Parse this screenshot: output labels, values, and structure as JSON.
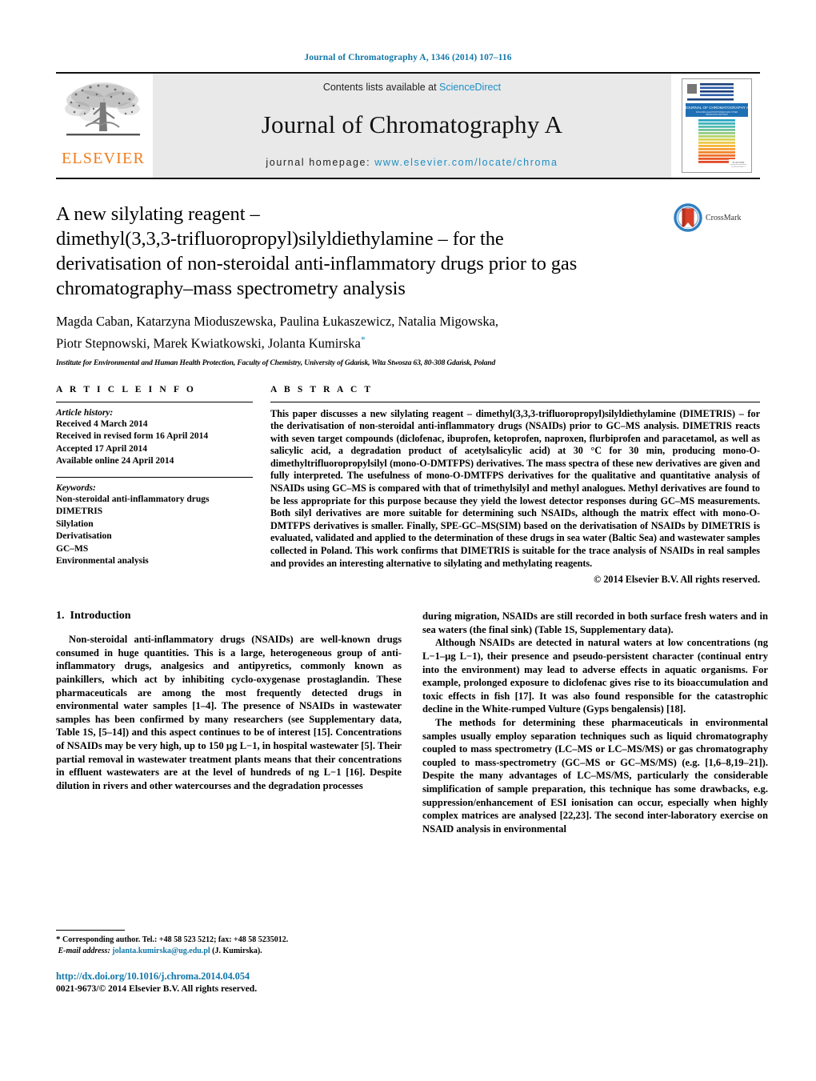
{
  "running_head": "Journal of Chromatography A, 1346 (2014) 107–116",
  "masthead": {
    "publisher_name": "ELSEVIER",
    "contents_prefix": "Contents lists available at ",
    "contents_link": "ScienceDirect",
    "journal_name": "Journal of Chromatography A",
    "homepage_prefix": "journal homepage: ",
    "homepage_url": "www.elsevier.com/locate/chroma",
    "cover_title": "JOURNAL OF CHROMATOGRAPHY A",
    "cover_subtitle": "INCLUDING ELECTROPHORESIS AND OTHER SEPARATION METHODS"
  },
  "article": {
    "title_lines": [
      "A new silylating reagent –",
      "dimethyl(3,3,3-trifluoropropyl)silyldiethylamine – for the",
      "derivatisation of non-steroidal anti-inflammatory drugs prior to gas",
      "chromatography–mass spectrometry analysis"
    ],
    "crossmark_label": "CrossMark",
    "authors_line_1": "Magda Caban, Katarzyna Mioduszewska, Paulina Łukaszewicz, Natalia Migowska,",
    "authors_line_2": "Piotr Stepnowski, Marek Kwiatkowski, Jolanta Kumirska",
    "corresponding_marker": "*",
    "affiliation": "Institute for Environmental and Human Health Protection, Faculty of Chemistry, University of Gdańsk, Wita Stwosza 63, 80-308 Gdańsk, Poland"
  },
  "article_info": {
    "heading": "A R T I C L E   I N F O",
    "history_label": "Article history:",
    "history": [
      "Received 4 March 2014",
      "Received in revised form 16 April 2014",
      "Accepted 17 April 2014",
      "Available online 24 April 2014"
    ],
    "keywords_label": "Keywords:",
    "keywords": [
      "Non-steroidal anti-inflammatory drugs",
      "DIMETRIS",
      "Silylation",
      "Derivatisation",
      "GC–MS",
      "Environmental analysis"
    ]
  },
  "abstract": {
    "heading": "A B S T R A C T",
    "text": "This paper discusses a new silylating reagent – dimethyl(3,3,3-trifluoropropyl)silyldiethylamine (DIMETRIS) – for the derivatisation of non-steroidal anti-inflammatory drugs (NSAIDs) prior to GC–MS analysis. DIMETRIS reacts with seven target compounds (diclofenac, ibuprofen, ketoprofen, naproxen, flurbiprofen and paracetamol, as well as salicylic acid, a degradation product of acetylsalicylic acid) at 30 °C for 30 min, producing mono-O-dimethyltrifluoropropylsilyl (mono-O-DMTFPS) derivatives. The mass spectra of these new derivatives are given and fully interpreted. The usefulness of mono-O-DMTFPS derivatives for the qualitative and quantitative analysis of NSAIDs using GC–MS is compared with that of trimethylsilyl and methyl analogues. Methyl derivatives are found to be less appropriate for this purpose because they yield the lowest detector responses during GC–MS measurements. Both silyl derivatives are more suitable for determining such NSAIDs, although the matrix effect with mono-O-DMTFPS derivatives is smaller. Finally, SPE-GC–MS(SIM) based on the derivatisation of NSAIDs by DIMETRIS is evaluated, validated and applied to the determination of these drugs in sea water (Baltic Sea) and wastewater samples collected in Poland. This work confirms that DIMETRIS is suitable for the trace analysis of NSAIDs in real samples and provides an interesting alternative to silylating and methylating reagents.",
    "copyright": "© 2014 Elsevier B.V. All rights reserved."
  },
  "introduction": {
    "section_number": "1.",
    "section_title": "Introduction",
    "left_paragraphs": [
      "Non-steroidal anti-inflammatory drugs (NSAIDs) are well-known drugs consumed in huge quantities. This is a large, heterogeneous group of anti-inflammatory drugs, analgesics and antipyretics, commonly known as painkillers, which act by inhibiting cyclo-oxygenase prostaglandin. These pharmaceuticals are among the most frequently detected drugs in environmental water samples [1–4]. The presence of NSAIDs in wastewater samples has been confirmed by many researchers (see Supplementary data, Table 1S, [5–14]) and this aspect continues to be of interest [15]. Concentrations of NSAIDs may be very high, up to 150 µg L−1, in hospital wastewater [5]. Their partial removal in wastewater treatment plants means that their concentrations in effluent wastewaters are at the level of hundreds of ng L−1 [16]. Despite dilution in rivers and other watercourses and the degradation processes"
    ],
    "right_paragraphs": [
      "during migration, NSAIDs are still recorded in both surface fresh waters and in sea waters (the final sink) (Table 1S, Supplementary data).",
      "Although NSAIDs are detected in natural waters at low concentrations (ng L−1–µg L−1), their presence and pseudo-persistent character (continual entry into the environment) may lead to adverse effects in aquatic organisms. For example, prolonged exposure to diclofenac gives rise to its bioaccumulation and toxic effects in fish [17]. It was also found responsible for the catastrophic decline in the White-rumped Vulture (Gyps bengalensis) [18].",
      "The methods for determining these pharmaceuticals in environmental samples usually employ separation techniques such as liquid chromatography coupled to mass spectrometry (LC–MS or LC–MS/MS) or gas chromatography coupled to mass-spectrometry (GC–MS or GC–MS/MS) (e.g. [1,6–8,19–21]). Despite the many advantages of LC–MS/MS, particularly the considerable simplification of sample preparation, this technique has some drawbacks, e.g. suppression/enhancement of ESI ionisation can occur, especially when highly complex matrices are analysed [22,23]. The second inter-laboratory exercise on NSAID analysis in environmental"
    ]
  },
  "footer": {
    "corresponding_note": "Corresponding author. Tel.: +48 58 523 5212; fax: +48 58 5235012.",
    "email_label": "E-mail address:",
    "email": "jolanta.kumirska@ug.edu.pl",
    "email_suffix": "(J. Kumirska).",
    "doi": "http://dx.doi.org/10.1016/j.chroma.2014.04.054",
    "issn_line": "0021-9673/© 2014 Elsevier B.V. All rights reserved."
  },
  "colors": {
    "link_blue": "#1277a8",
    "sciencedirect_blue": "#1d8fc4",
    "elsevier_orange": "#f07c1a",
    "banner_gray": "#e9e9e9"
  }
}
